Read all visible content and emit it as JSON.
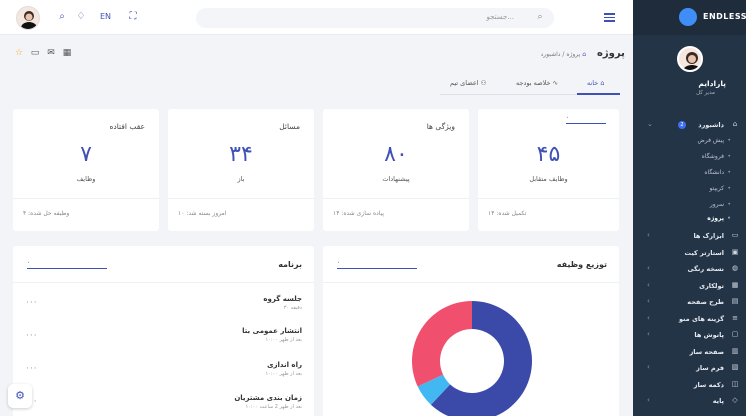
{
  "topbar": {
    "lang": "EN",
    "search_placeholder": "جستجو..."
  },
  "brand": {
    "name": "ENDLESS"
  },
  "user": {
    "name": "پارادایم",
    "role": "مدیر کل"
  },
  "menu": {
    "dashboard": {
      "label": "داشبورد",
      "badge": "2"
    },
    "dashboard_sub": [
      "پیش فرض",
      "فروشگاه",
      "دانشگاه",
      "کریپتو",
      "سرور",
      "پروژه"
    ],
    "items": [
      "ابزارک ها",
      "استارتر کیت",
      "نسخه رنگی",
      "تولکاری",
      "طرح صفحه",
      "گزینه های منو",
      "پانوش ها",
      "صفحه ساز",
      "فرم ساز",
      "دکمه ساز",
      "پایه"
    ]
  },
  "page": {
    "title": "پروژه",
    "breadcrumb": [
      "داشبورد",
      "پروژه"
    ]
  },
  "tabs": [
    "خانه",
    "خلاصه بودجه",
    "اعضای تیم"
  ],
  "stats": [
    {
      "select": "۰",
      "title": "",
      "value": "۴۵",
      "label": "وظایف متقابل",
      "footer": "تکمیل شده: ۱۴"
    },
    {
      "title": "ویژگی ها",
      "value": "۸۰",
      "label": "پیشنهادات",
      "footer": "پیاده سازی شده: ۱۴"
    },
    {
      "title": "مسائل",
      "value": "۳۴",
      "label": "باز",
      "footer": "امروز بسته شد: ۱۰"
    },
    {
      "title": "عقب افتاده",
      "value": "۷",
      "label": "وظایف",
      "footer": "وظیفه حل شده: ۴"
    }
  ],
  "distribution": {
    "title": "توزیع وظیفه",
    "select": "۰"
  },
  "program": {
    "title": "برنامه",
    "select": "۰",
    "events": [
      {
        "title": "جلسه گروه",
        "sub": "۳۰ دقیقه"
      },
      {
        "title": "انتشار عمومی بتا",
        "sub": "۱۰:۰۰ بعد از ظهر"
      },
      {
        "title": "راه اندازی",
        "sub": "۱۰:۰۰ بعد از ظهر"
      },
      {
        "title": "زمان بندی مشتریان",
        "sub": "۱۰:۰۰ بعد از ظهر 2 ساعت"
      }
    ]
  },
  "chart_data": {
    "type": "pie",
    "values": [
      62,
      6,
      32
    ],
    "colors": [
      "#3b49a8",
      "#42b8f3",
      "#f0506e"
    ]
  }
}
